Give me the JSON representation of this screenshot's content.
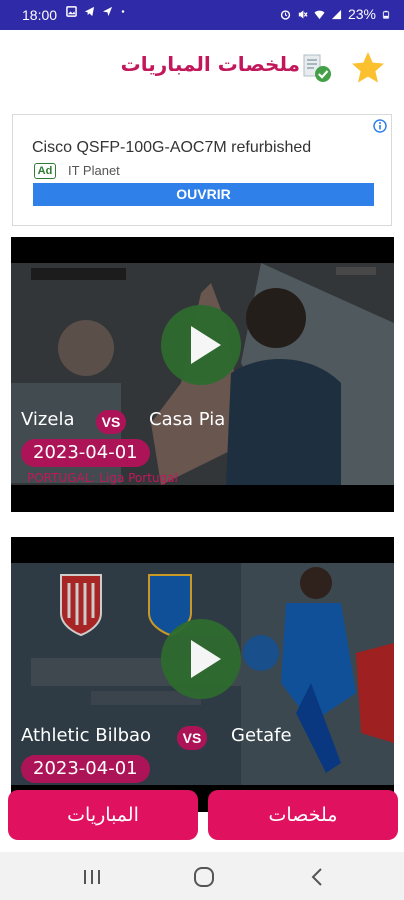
{
  "status_bar": {
    "time": "18:00",
    "battery": "23%",
    "left_icons": [
      "image-icon",
      "telegram-icon",
      "location-icon",
      "dot-icon"
    ],
    "right_icons": [
      "alarm-icon",
      "mute-icon",
      "wifi-icon",
      "signal-icon",
      "battery-icon"
    ]
  },
  "header": {
    "title": "ملخصات المباريات",
    "icons": [
      "star-icon",
      "verified-document-icon"
    ],
    "accent_color": "#c2185b"
  },
  "ad": {
    "title": "Cisco QSFP-100G-AOC7M refurbished",
    "badge": "Ad",
    "advertiser": "IT Planet",
    "cta": "OUVRIR",
    "cta_color": "#2f80e8"
  },
  "matches": [
    {
      "home": "Vizela",
      "vs": "VS",
      "away": "Casa Pia",
      "date": "2023-04-01",
      "league": "PORTUGAL: Liga Portugal"
    },
    {
      "home": "Athletic Bilbao",
      "vs": "VS",
      "away": "Getafe",
      "date": "2023-04-01"
    }
  ],
  "bottom_nav": {
    "left_label": "المباريات",
    "right_label": "ملخصات",
    "color": "#e0115f"
  },
  "system_nav": [
    "recents-icon",
    "home-icon",
    "back-icon"
  ]
}
